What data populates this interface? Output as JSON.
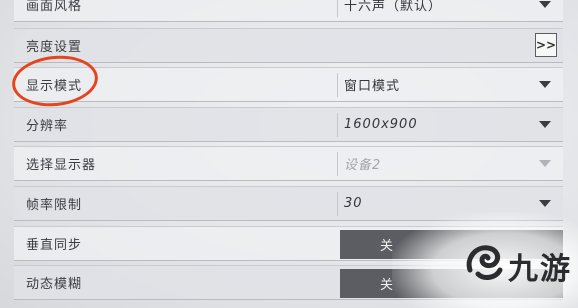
{
  "settings": [
    {
      "label": "画面风格",
      "value": "十六声（默认）",
      "control": "dropdown"
    },
    {
      "label": "亮度设置",
      "value": "",
      "control": "expand",
      "button_label": ">>"
    },
    {
      "label": "显示模式",
      "value": "窗口模式",
      "control": "dropdown"
    },
    {
      "label": "分辨率",
      "value": "1600x900",
      "control": "dropdown"
    },
    {
      "label": "选择显示器",
      "value": "设备2",
      "control": "dropdown",
      "disabled": true
    },
    {
      "label": "帧率限制",
      "value": "30",
      "control": "dropdown"
    },
    {
      "label": "垂直同步",
      "value": "关",
      "control": "toggle"
    },
    {
      "label": "动态模糊",
      "value": "关",
      "control": "toggle"
    }
  ],
  "annotation": {
    "color": "#e3461f",
    "target": "显示模式"
  },
  "watermark": {
    "text": "九游"
  }
}
